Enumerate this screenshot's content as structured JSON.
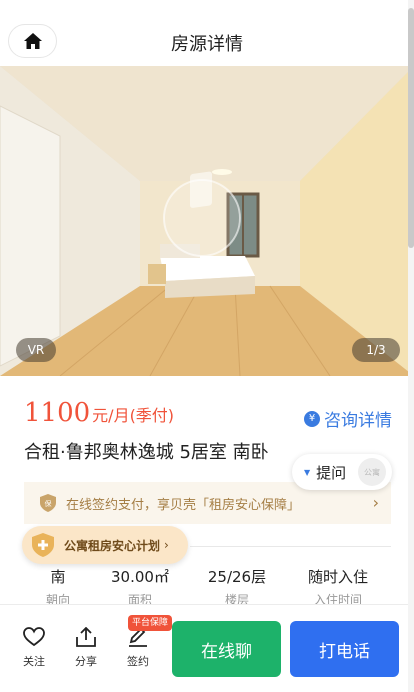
{
  "header": {
    "title": "房源详情",
    "home_icon": "home-icon"
  },
  "gallery": {
    "vr_label": "VR",
    "counter": "1/3"
  },
  "price": {
    "amount": "1100",
    "unit": "元/月(季付)"
  },
  "consult": {
    "icon_text": "¥",
    "label": "咨询详情"
  },
  "house": {
    "title": "合租·鲁邦奥林逸城 5居室 南卧"
  },
  "ask": {
    "label": "提问",
    "avatar_text": "公寓"
  },
  "guarantee": {
    "text": "在线签约支付，享贝壳「租房安心保障」"
  },
  "plan": {
    "label": "公寓租房安心计划"
  },
  "attributes": [
    {
      "value": "南",
      "label": "朝向"
    },
    {
      "value": "30.00㎡",
      "label": "面积"
    },
    {
      "value": "25/26层",
      "label": "楼层"
    },
    {
      "value": "随时入住",
      "label": "入住时间"
    }
  ],
  "bottom_bar": {
    "follow_label": "关注",
    "share_label": "分享",
    "sign_label": "签约",
    "sign_badge": "平台保障",
    "chat_button": "在线聊",
    "call_button": "打电话"
  },
  "colors": {
    "price": "#f0533a",
    "link": "#3a7be0",
    "chat": "#1db26a",
    "call": "#2f6ff0",
    "guarantee_text": "#a57e45"
  }
}
